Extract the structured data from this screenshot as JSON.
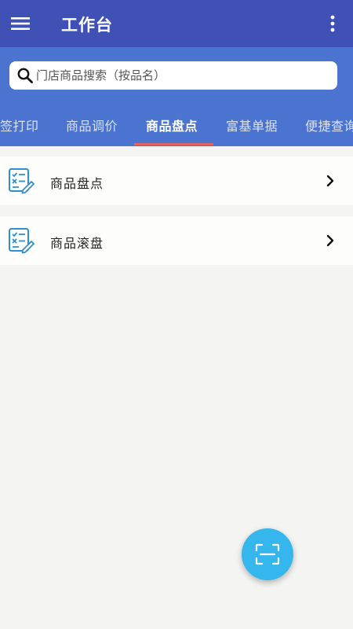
{
  "appbar": {
    "title": "工作台",
    "menu_icon": "hamburger-menu-icon",
    "more_icon": "more-vertical-icon"
  },
  "search": {
    "placeholder": "门店商品搜索（按品名）",
    "value": "",
    "icon": "search-icon"
  },
  "tabs": [
    {
      "label": "签打印",
      "active": false
    },
    {
      "label": "商品调价",
      "active": false
    },
    {
      "label": "商品盘点",
      "active": true
    },
    {
      "label": "富基单据",
      "active": false
    },
    {
      "label": "便捷查询",
      "active": false
    }
  ],
  "items": [
    {
      "label": "商品盘点",
      "icon": "checklist-edit-icon"
    },
    {
      "label": "商品滚盘",
      "icon": "checklist-edit-icon"
    }
  ],
  "fab": {
    "icon": "scan-icon"
  },
  "colors": {
    "appbar": "#3f51b5",
    "header": "#4a74cf",
    "indicator": "#e06363",
    "fab": "#35b6ec",
    "icon_blue": "#2f8fd6"
  }
}
